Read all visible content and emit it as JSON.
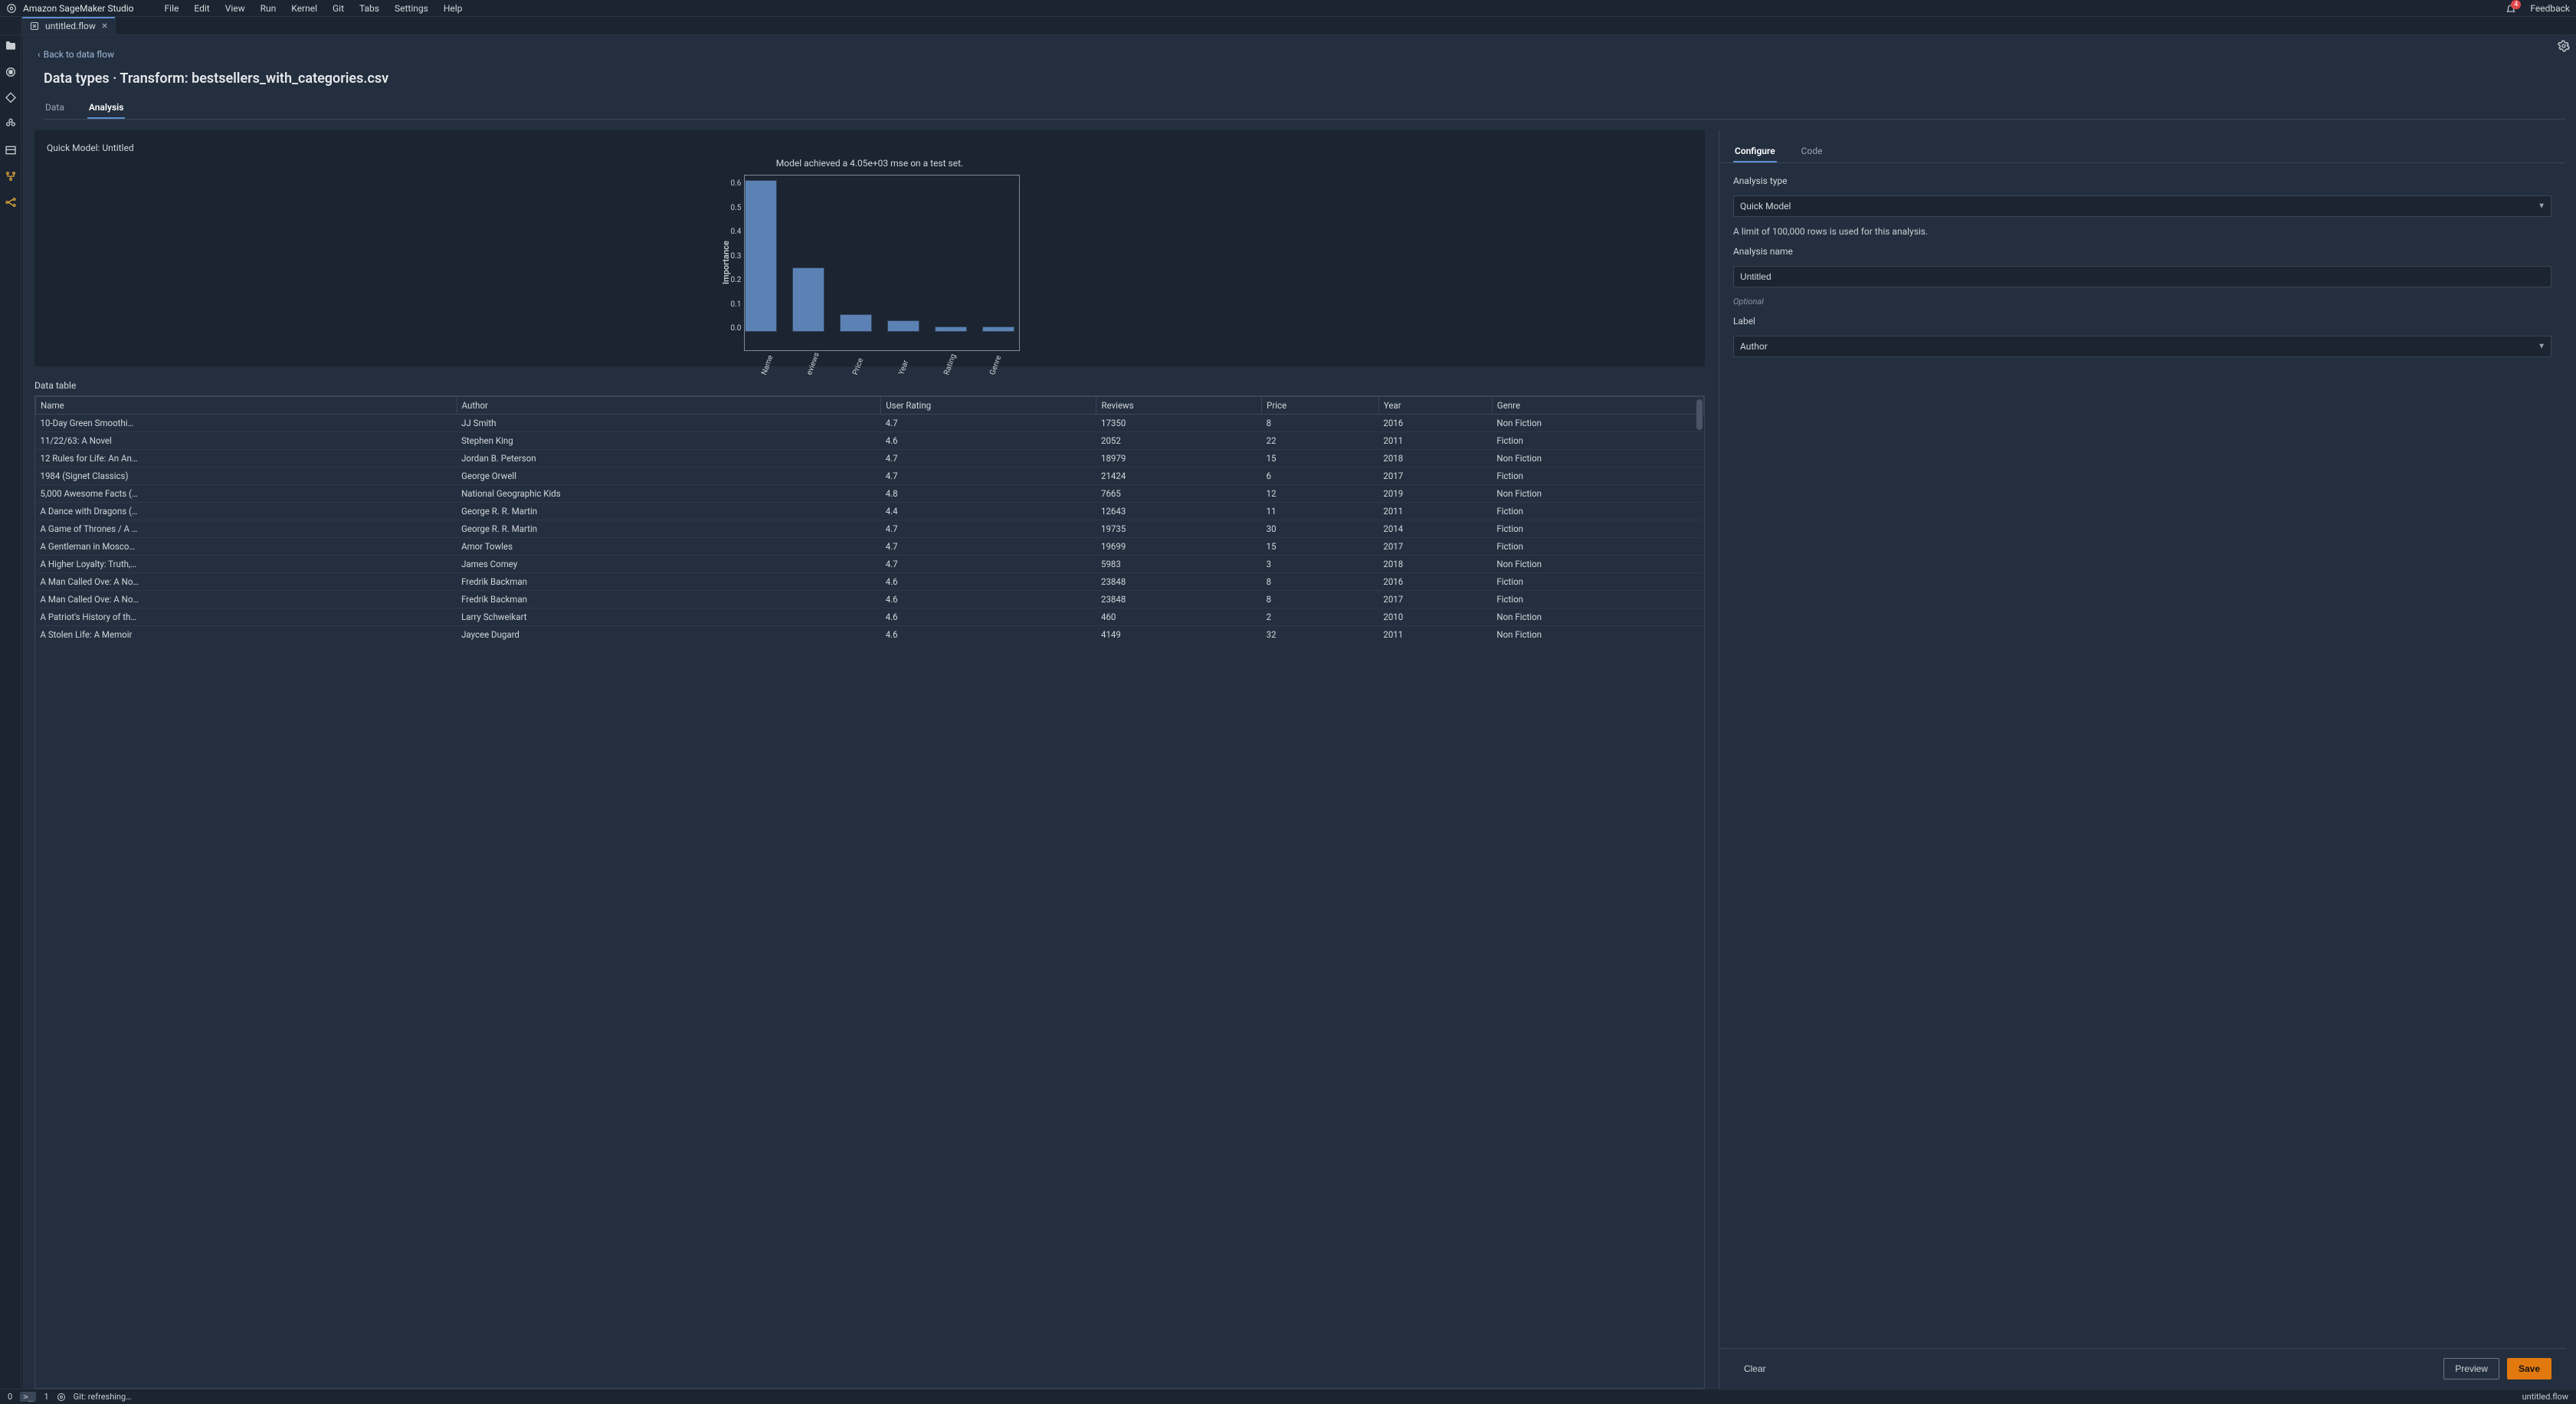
{
  "app": {
    "title": "Amazon SageMaker Studio",
    "feedback": "Feedback",
    "notif_count": "4"
  },
  "menubar": [
    "File",
    "Edit",
    "View",
    "Run",
    "Kernel",
    "Git",
    "Tabs",
    "Settings",
    "Help"
  ],
  "file_tab": {
    "name": "untitled.flow"
  },
  "page": {
    "back_label": "Back to data flow",
    "heading": "Data types · Transform: bestsellers_with_categories.csv",
    "subtabs": {
      "data": "Data",
      "analysis": "Analysis"
    }
  },
  "chart_card": {
    "header": "Quick Model: Untitled",
    "subtitle": "Model achieved a 4.05e+03 mse on a test set."
  },
  "chart_data": {
    "type": "bar",
    "categories": [
      "Name",
      "eviews",
      "Price",
      "Year",
      "Rating",
      "Genre"
    ],
    "values": [
      0.62,
      0.255,
      0.07,
      0.045,
      0.02,
      0.02
    ],
    "ylabel": "Importance",
    "ylim": [
      0.0,
      0.6
    ],
    "yticks": [
      "0.0",
      "0.1",
      "0.2",
      "0.3",
      "0.4",
      "0.5",
      "0.6"
    ]
  },
  "table": {
    "label": "Data table",
    "columns": [
      "Name",
      "Author",
      "User Rating",
      "Reviews",
      "Price",
      "Year",
      "Genre"
    ],
    "rows": [
      [
        "10-Day Green Smoothi…",
        "JJ Smith",
        "4.7",
        "17350",
        "8",
        "2016",
        "Non Fiction"
      ],
      [
        "11/22/63: A Novel",
        "Stephen King",
        "4.6",
        "2052",
        "22",
        "2011",
        "Fiction"
      ],
      [
        "12 Rules for Life: An An…",
        "Jordan B. Peterson",
        "4.7",
        "18979",
        "15",
        "2018",
        "Non Fiction"
      ],
      [
        "1984 (Signet Classics)",
        "George Orwell",
        "4.7",
        "21424",
        "6",
        "2017",
        "Fiction"
      ],
      [
        "5,000 Awesome Facts (…",
        "National Geographic Kids",
        "4.8",
        "7665",
        "12",
        "2019",
        "Non Fiction"
      ],
      [
        "A Dance with Dragons (…",
        "George R. R. Martin",
        "4.4",
        "12643",
        "11",
        "2011",
        "Fiction"
      ],
      [
        "A Game of Thrones / A …",
        "George R. R. Martin",
        "4.7",
        "19735",
        "30",
        "2014",
        "Fiction"
      ],
      [
        "A Gentleman in Mosco…",
        "Amor Towles",
        "4.7",
        "19699",
        "15",
        "2017",
        "Fiction"
      ],
      [
        "A Higher Loyalty: Truth,…",
        "James Comey",
        "4.7",
        "5983",
        "3",
        "2018",
        "Non Fiction"
      ],
      [
        "A Man Called Ove: A No…",
        "Fredrik Backman",
        "4.6",
        "23848",
        "8",
        "2016",
        "Fiction"
      ],
      [
        "A Man Called Ove: A No…",
        "Fredrik Backman",
        "4.6",
        "23848",
        "8",
        "2017",
        "Fiction"
      ],
      [
        "A Patriot's History of th…",
        "Larry Schweikart",
        "4.6",
        "460",
        "2",
        "2010",
        "Non Fiction"
      ],
      [
        "A Stolen Life: A Memoir",
        "Jaycee Dugard",
        "4.6",
        "4149",
        "32",
        "2011",
        "Non Fiction"
      ]
    ]
  },
  "config": {
    "tabs": {
      "configure": "Configure",
      "code": "Code"
    },
    "analysis_type_label": "Analysis type",
    "analysis_type_value": "Quick Model",
    "limit_note": "A limit of 100,000 rows is used for this analysis.",
    "analysis_name_label": "Analysis name",
    "analysis_name_value": "Untitled",
    "optional_hint": "Optional",
    "label_label": "Label",
    "label_value": "Author",
    "buttons": {
      "clear": "Clear",
      "preview": "Preview",
      "save": "Save"
    }
  },
  "status": {
    "zero": "0",
    "one": "1",
    "git": "Git: refreshing…",
    "filename": "untitled.flow"
  }
}
